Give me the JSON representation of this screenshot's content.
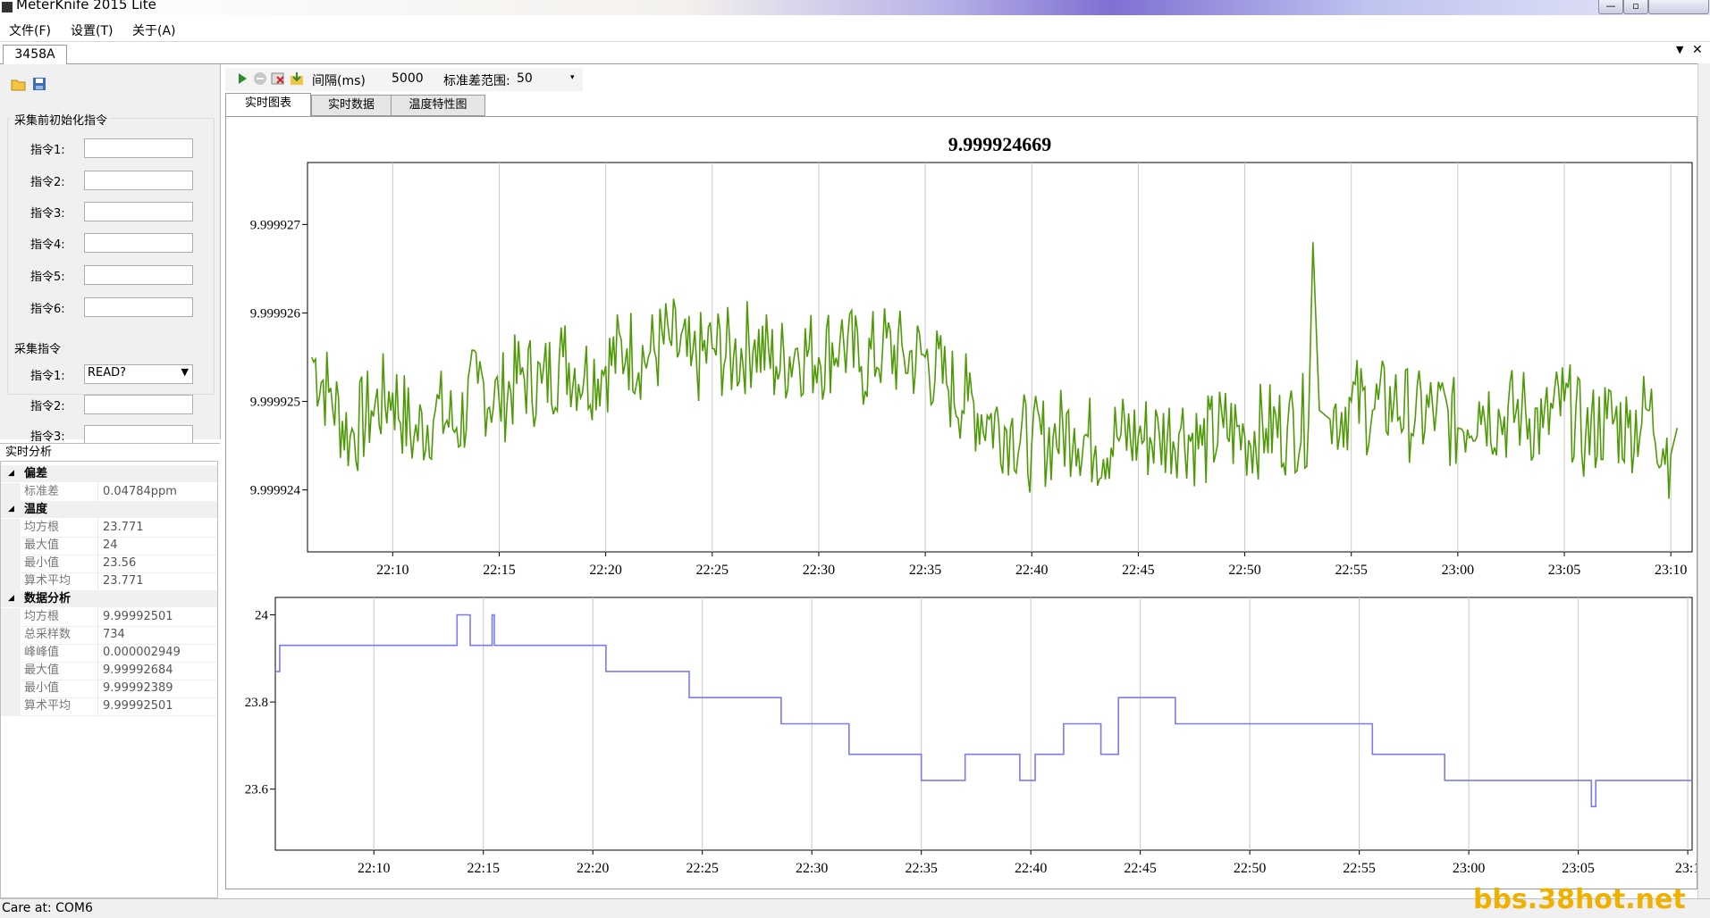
{
  "window": {
    "title": "MeterKnife 2015 Lite"
  },
  "menu": {
    "file": "文件(F)",
    "settings": "设置(T)",
    "about": "关于(A)"
  },
  "document_tab": "3458A",
  "left_panel": {
    "init_group_title": "采集前初始化指令",
    "init_commands": [
      {
        "label": "指令1:",
        "value": ""
      },
      {
        "label": "指令2:",
        "value": ""
      },
      {
        "label": "指令3:",
        "value": ""
      },
      {
        "label": "指令4:",
        "value": ""
      },
      {
        "label": "指令5:",
        "value": ""
      },
      {
        "label": "指令6:",
        "value": ""
      }
    ],
    "acq_group_title": "采集指令",
    "acq_commands": [
      {
        "label": "指令1:",
        "value": "READ?"
      },
      {
        "label": "指令2:",
        "value": ""
      },
      {
        "label": "指令3:",
        "value": ""
      }
    ]
  },
  "analysis": {
    "header": "实时分析",
    "sections": [
      {
        "name": "偏差",
        "rows": [
          {
            "k": "标准差",
            "v": "0.04784ppm"
          }
        ]
      },
      {
        "name": "温度",
        "rows": [
          {
            "k": "均方根",
            "v": "23.771"
          },
          {
            "k": "最大值",
            "v": "24"
          },
          {
            "k": "最小值",
            "v": "23.56"
          },
          {
            "k": "算术平均",
            "v": "23.771"
          }
        ]
      },
      {
        "name": "数据分析",
        "rows": [
          {
            "k": "均方根",
            "v": "9.99992501"
          },
          {
            "k": "总采样数",
            "v": "734"
          },
          {
            "k": "峰峰值",
            "v": "0.000002949"
          },
          {
            "k": "最大值",
            "v": "9.99992684"
          },
          {
            "k": "最小值",
            "v": "9.99992389"
          },
          {
            "k": "算术平均",
            "v": "9.99992501"
          }
        ]
      }
    ]
  },
  "toolbar": {
    "interval_label": "间隔(ms)",
    "interval_value": "5000",
    "std_range_label": "标准差范围:",
    "std_range_value": "50"
  },
  "tabs": [
    "实时图表",
    "实时数据",
    "温度特性图"
  ],
  "status": {
    "text": "Care at:  COM6"
  },
  "watermark": "bbs.38hot.net",
  "colors": {
    "voltage_series": "#4e9a06",
    "temperature_series": "#7b7bf0",
    "grid": "#c8c8c8"
  },
  "chart_data": [
    {
      "type": "line",
      "title": "9.999924669",
      "x_ticks": [
        "22:10",
        "22:15",
        "22:20",
        "22:25",
        "22:30",
        "22:35",
        "22:40",
        "22:45",
        "22:50",
        "22:55",
        "23:00",
        "23:05",
        "23:10"
      ],
      "y_ticks": [
        "9.999924",
        "9.999925",
        "9.999926",
        "9.999927"
      ],
      "ylim": [
        9.9999233,
        9.9999277
      ],
      "xlim_minutes_from_2210": [
        -4,
        61
      ],
      "series": [
        {
          "x_minutes_from_2210": [
            -3.8,
            -3,
            -2,
            -1,
            0,
            1,
            2,
            3,
            4,
            5,
            6,
            7,
            8,
            9,
            10,
            11,
            12,
            13,
            14,
            15,
            16,
            17,
            18,
            19,
            20,
            21,
            22,
            23,
            24,
            25,
            26,
            27,
            28,
            29,
            30,
            31,
            32,
            33,
            34,
            35,
            36,
            37,
            38,
            39,
            40,
            41,
            42,
            43,
            43.2,
            43.5,
            44,
            45,
            46,
            47,
            48,
            49,
            50,
            51,
            52,
            53,
            54,
            55,
            56,
            57,
            58,
            59,
            60,
            60.3
          ],
          "values": [
            9.9999255,
            9.9999251,
            9.9999246,
            9.9999249,
            9.9999251,
            9.9999246,
            9.9999249,
            9.9999247,
            9.9999252,
            9.999925,
            9.9999253,
            9.9999252,
            9.9999255,
            9.9999253,
            9.9999254,
            9.9999256,
            9.9999255,
            9.9999257,
            9.9999254,
            9.9999256,
            9.9999255,
            9.9999257,
            9.9999254,
            9.9999256,
            9.9999255,
            9.9999257,
            9.9999254,
            9.9999256,
            9.9999255,
            9.9999255,
            9.9999252,
            9.999925,
            9.9999248,
            9.9999247,
            9.9999245,
            9.9999246,
            9.9999247,
            9.9999245,
            9.9999246,
            9.9999246,
            9.9999246,
            9.9999247,
            9.9999245,
            9.9999247,
            9.9999246,
            9.9999247,
            9.9999247,
            9.9999248,
            9.9999268,
            9.9999249,
            9.9999248,
            9.999925,
            9.9999249,
            9.999925,
            9.9999248,
            9.9999249,
            9.9999247,
            9.999925,
            9.9999248,
            9.9999249,
            9.9999247,
            9.999925,
            9.9999246,
            9.9999248,
            9.9999247,
            9.9999249,
            9.9999244,
            9.9999247
          ]
        }
      ]
    },
    {
      "type": "line",
      "x_ticks": [
        "22:10",
        "22:15",
        "22:20",
        "22:25",
        "22:30",
        "22:35",
        "22:40",
        "22:45",
        "22:50",
        "22:55",
        "23:00",
        "23:05",
        "23:1"
      ],
      "y_ticks": [
        "23.6",
        "23.8",
        "24"
      ],
      "ylim": [
        23.46,
        24.04
      ],
      "xlim_minutes_from_2210": [
        -4.5,
        60.2
      ],
      "series": [
        {
          "x_minutes_from_2210": [
            -4.5,
            -4.3,
            3.8,
            3.8,
            4.4,
            5.4,
            5.5,
            10.1,
            10.6,
            10.8,
            14,
            14.4,
            14.5,
            18.3,
            18.6,
            21.3,
            21.7,
            24.7,
            25,
            26.5,
            27,
            27.8,
            29.5,
            30.2,
            31.3,
            31.5,
            32.6,
            33.2,
            34,
            36.2,
            36.6,
            36.7,
            45,
            45.6,
            45.8,
            48.7,
            48.9,
            54.8,
            55.6,
            55.8,
            59,
            59.4,
            60.2
          ],
          "values": [
            23.87,
            23.93,
            23.93,
            24,
            23.93,
            24,
            23.93,
            23.93,
            23.87,
            23.87,
            23.87,
            23.81,
            23.81,
            23.81,
            23.75,
            23.75,
            23.68,
            23.68,
            23.62,
            23.62,
            23.68,
            23.68,
            23.62,
            23.68,
            23.68,
            23.75,
            23.75,
            23.68,
            23.81,
            23.81,
            23.75,
            23.75,
            23.75,
            23.68,
            23.68,
            23.68,
            23.62,
            23.62,
            23.56,
            23.62,
            23.62,
            23.62,
            23.62
          ]
        }
      ]
    }
  ]
}
